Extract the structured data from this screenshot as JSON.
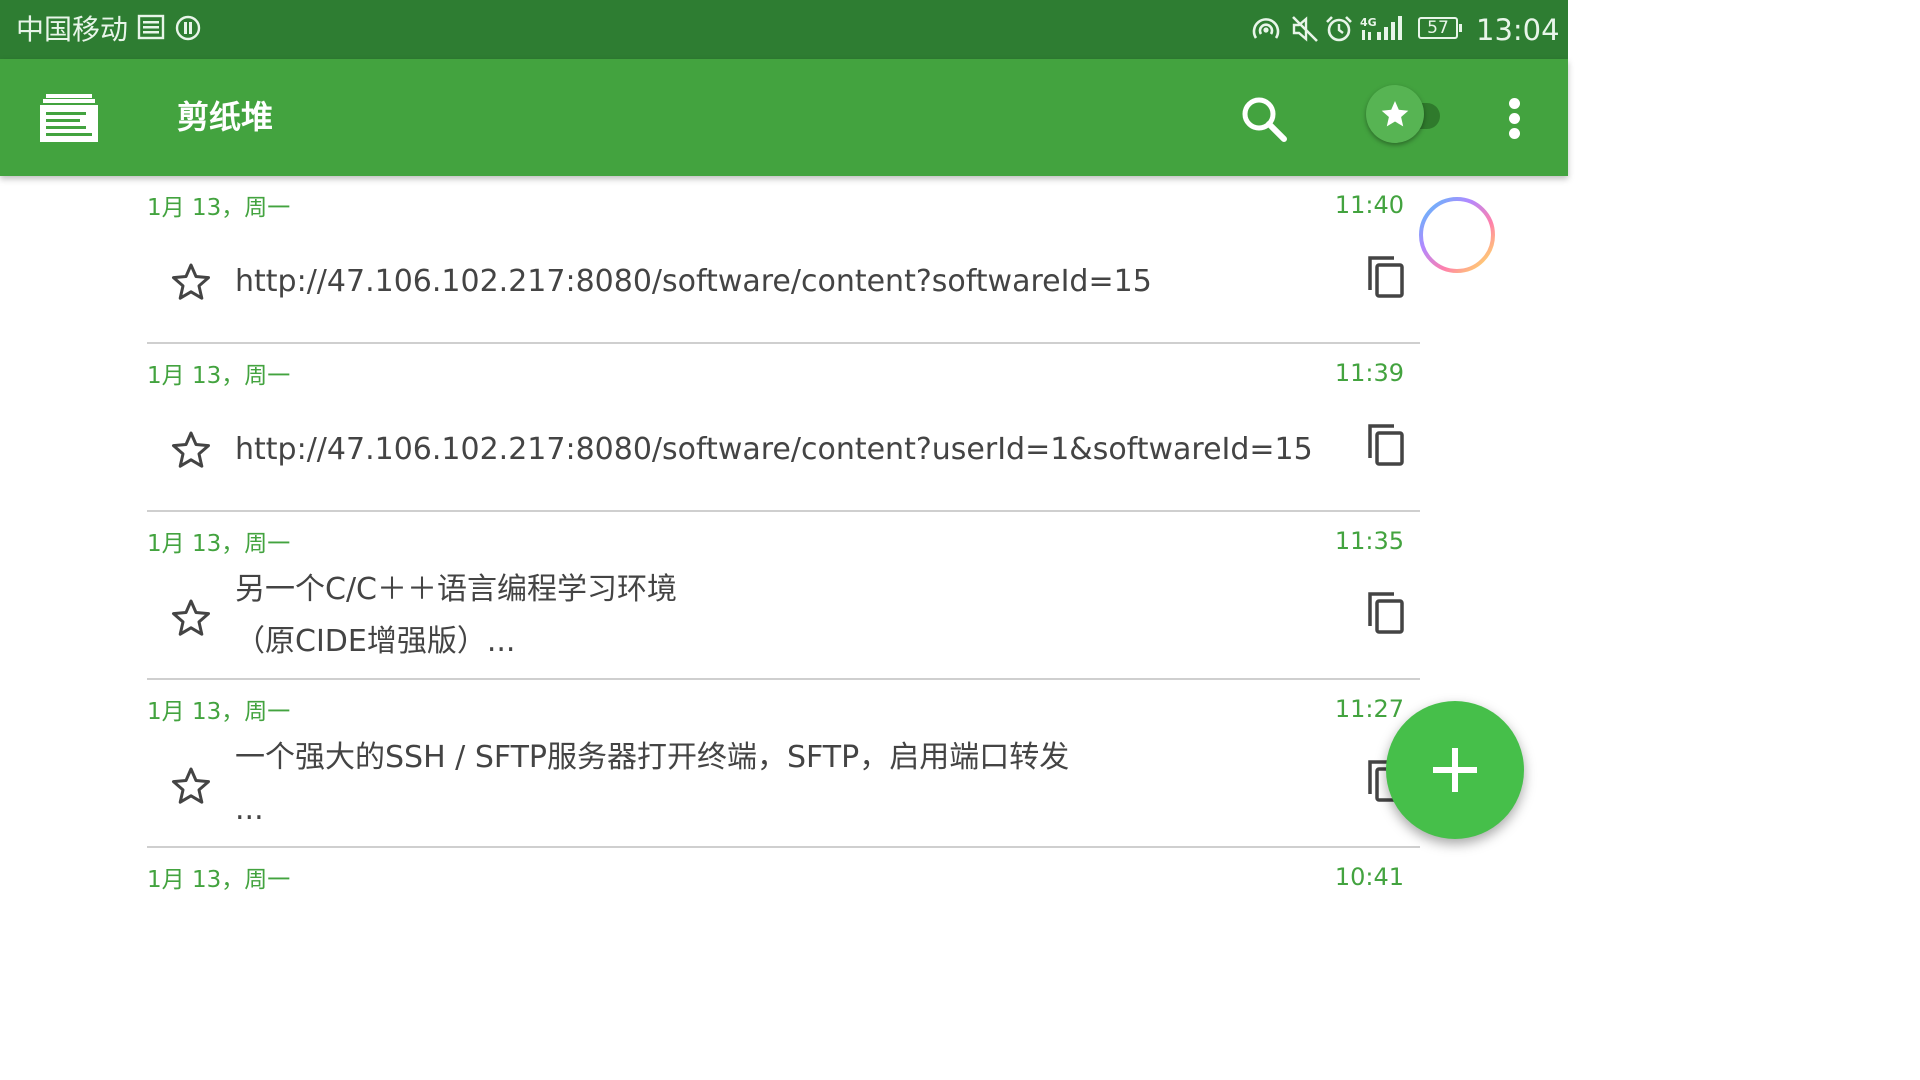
{
  "status_bar": {
    "carrier": "中国移动",
    "battery": "57",
    "time": "13:04",
    "icons": [
      "message-icon",
      "notification-icon",
      "hotspot-icon",
      "mute-icon",
      "alarm-icon",
      "signal-4g-icon",
      "battery-icon"
    ]
  },
  "toolbar": {
    "title": "剪纸堆",
    "icons": [
      "app-logo-icon",
      "search-icon",
      "star-icon",
      "more-vert-icon"
    ],
    "starred_filter_on": true
  },
  "items": [
    {
      "date": "1月 13，周一",
      "time": "11:40",
      "text": "http://47.106.102.217:8080/software/content?softwareId=15",
      "starred": false
    },
    {
      "date": "1月 13，周一",
      "time": "11:39",
      "text": "http://47.106.102.217:8080/software/content?userId=1&softwareId=15",
      "starred": false
    },
    {
      "date": "1月 13，周一",
      "time": "11:35",
      "text": "另一个C/C＋＋语言编程学习环境\n（原CIDE增强版）...",
      "starred": false
    },
    {
      "date": "1月 13，周一",
      "time": "11:27",
      "text": "一个强大的SSH / SFTP服务器打开终端，SFTP，启用端口转发\n...",
      "starred": false
    },
    {
      "date": "1月 13，周一",
      "time": "10:41",
      "text": "",
      "starred": false
    }
  ],
  "colors": {
    "status_bar": "#2e7d32",
    "toolbar": "#43a33f",
    "accent": "#43a33f",
    "fab": "#46bf4a",
    "divider": "#cfcfcf",
    "text": "#444444"
  },
  "fab": {
    "icon": "plus-icon"
  }
}
